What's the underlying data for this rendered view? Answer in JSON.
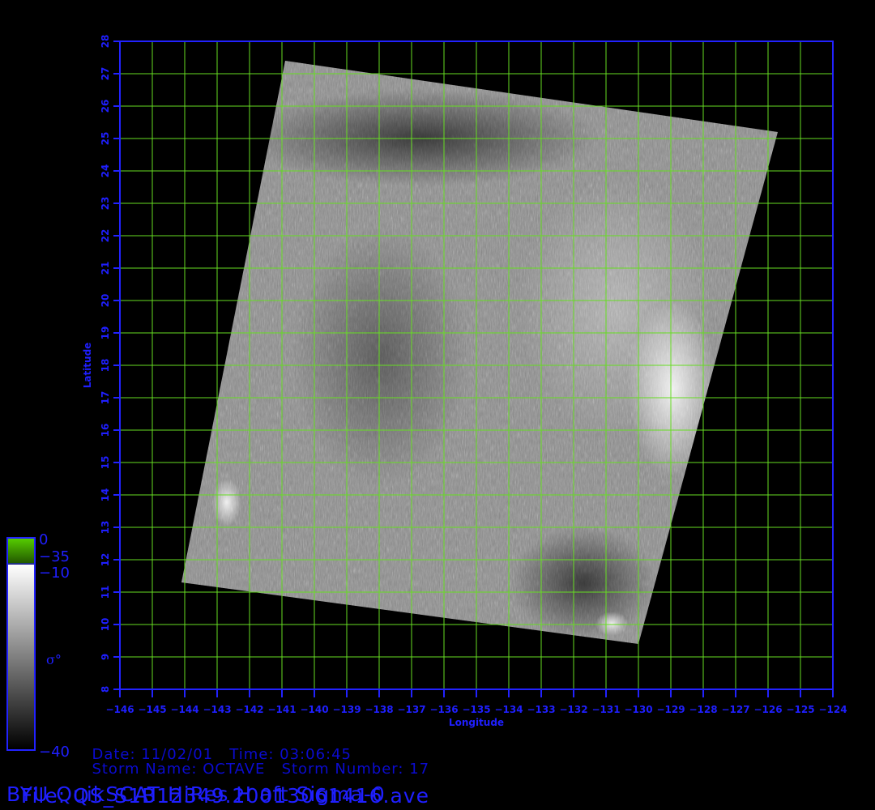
{
  "map": {
    "x_axis_label": "Longitude",
    "y_axis_label": "Latitude",
    "lon_range": [
      -146,
      -124
    ],
    "lat_range": [
      8,
      28
    ],
    "lon_ticks": [
      -146,
      -145,
      -144,
      -143,
      -142,
      -141,
      -140,
      -139,
      -138,
      -137,
      -136,
      -135,
      -134,
      -133,
      -132,
      -131,
      -130,
      -129,
      -128,
      -127,
      -126,
      -125,
      -124
    ],
    "lat_ticks": [
      8,
      9,
      10,
      11,
      12,
      13,
      14,
      15,
      16,
      17,
      18,
      19,
      20,
      21,
      22,
      23,
      24,
      25,
      26,
      27,
      28
    ],
    "lon_tick_labels": [
      "−146",
      "−145",
      "−144",
      "−143",
      "−142",
      "−141",
      "−140",
      "−139",
      "−138",
      "−137",
      "−136",
      "−135",
      "−134",
      "−133",
      "−132",
      "−131",
      "−130",
      "−129",
      "−128",
      "−127",
      "−126",
      "−125",
      "−124"
    ],
    "lat_tick_labels": [
      "8",
      "9",
      "10",
      "11",
      "12",
      "13",
      "14",
      "15",
      "16",
      "17",
      "18",
      "19",
      "20",
      "21",
      "22",
      "23",
      "24",
      "25",
      "26",
      "27",
      "28"
    ],
    "grid": true,
    "grid_color": "#66dd22",
    "axis_color": "#2222ff",
    "swath_corners_lonlat": [
      [
        -140.9,
        27.4
      ],
      [
        -125.7,
        25.2
      ],
      [
        -130.0,
        9.4
      ],
      [
        -144.1,
        11.3
      ]
    ]
  },
  "colorbar": {
    "labels": [
      "0",
      "−35",
      "−10",
      "−40"
    ],
    "symbol": "σ°",
    "top_color": "#44aa00",
    "gradient_top": "#ffffff",
    "gradient_bottom": "#000000"
  },
  "info": {
    "date_label": "Date:",
    "date_value": "11/02/01",
    "time_label": "Time:",
    "time_value": "03:06:45",
    "storm_name_label": "Storm Name:",
    "storm_name_value": "OCTAVE",
    "storm_number_label": "Storm Number:",
    "storm_number_value": "17",
    "file_label": "File:",
    "file_value": "QS_S1B12349.20013061416.ave",
    "product_title": "BYU QuikSCAT HiRes H aft Sigma-0"
  }
}
